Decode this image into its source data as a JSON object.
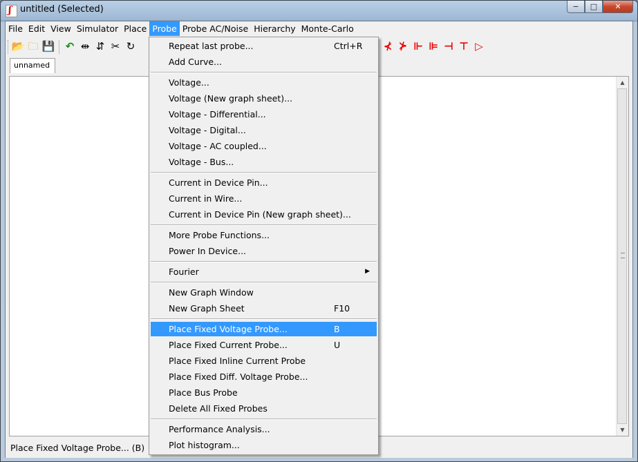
{
  "window": {
    "title": "untitled (Selected)",
    "controls": {
      "minimize": "−",
      "maximize": "□",
      "close": "✕"
    }
  },
  "menubar": [
    "File",
    "Edit",
    "View",
    "Simulator",
    "Place",
    "Probe",
    "Probe AC/Noise",
    "Hierarchy",
    "Monte-Carlo"
  ],
  "toolbar": {
    "left_icons": [
      "open-folder-icon",
      "new-folder-icon",
      "save-icon",
      "undo-icon",
      "mirror-icon",
      "flip-icon",
      "cut-icon",
      "rotate-icon"
    ],
    "right_icons": [
      "npn-icon",
      "pnp-icon",
      "nmos-icon",
      "pmos-icon",
      "njfet-icon",
      "pjfet-icon",
      "opamp-icon"
    ]
  },
  "tabs": [
    "unnamed"
  ],
  "statusbar": {
    "text": "Place Fixed Voltage Probe... (B)"
  },
  "probe_menu": {
    "groups": [
      [
        {
          "label": "Repeat last probe...",
          "shortcut": "Ctrl+R"
        },
        {
          "label": "Add Curve...",
          "shortcut": ""
        }
      ],
      [
        {
          "label": "Voltage...",
          "shortcut": ""
        },
        {
          "label": "Voltage (New graph sheet)...",
          "shortcut": ""
        },
        {
          "label": "Voltage - Differential...",
          "shortcut": ""
        },
        {
          "label": "Voltage - Digital...",
          "shortcut": ""
        },
        {
          "label": "Voltage - AC coupled...",
          "shortcut": ""
        },
        {
          "label": "Voltage - Bus...",
          "shortcut": ""
        }
      ],
      [
        {
          "label": "Current in Device Pin...",
          "shortcut": ""
        },
        {
          "label": "Current in Wire...",
          "shortcut": ""
        },
        {
          "label": "Current in Device Pin (New graph sheet)...",
          "shortcut": ""
        }
      ],
      [
        {
          "label": "More Probe Functions...",
          "shortcut": ""
        },
        {
          "label": "Power In Device...",
          "shortcut": ""
        }
      ],
      [
        {
          "label": "Fourier",
          "shortcut": "",
          "submenu": true
        }
      ],
      [
        {
          "label": "New Graph Window",
          "shortcut": ""
        },
        {
          "label": "New Graph Sheet",
          "shortcut": "F10"
        }
      ],
      [
        {
          "label": "Place Fixed Voltage Probe...",
          "shortcut": "B",
          "highlighted": true
        },
        {
          "label": "Place Fixed Current Probe...",
          "shortcut": "U"
        },
        {
          "label": "Place Fixed Inline Current Probe",
          "shortcut": ""
        },
        {
          "label": "Place Fixed Diff. Voltage Probe...",
          "shortcut": ""
        },
        {
          "label": "Place Bus Probe",
          "shortcut": ""
        },
        {
          "label": "Delete All Fixed Probes",
          "shortcut": ""
        }
      ],
      [
        {
          "label": "Performance Analysis...",
          "shortcut": ""
        },
        {
          "label": "Plot histogram...",
          "shortcut": ""
        }
      ]
    ]
  }
}
